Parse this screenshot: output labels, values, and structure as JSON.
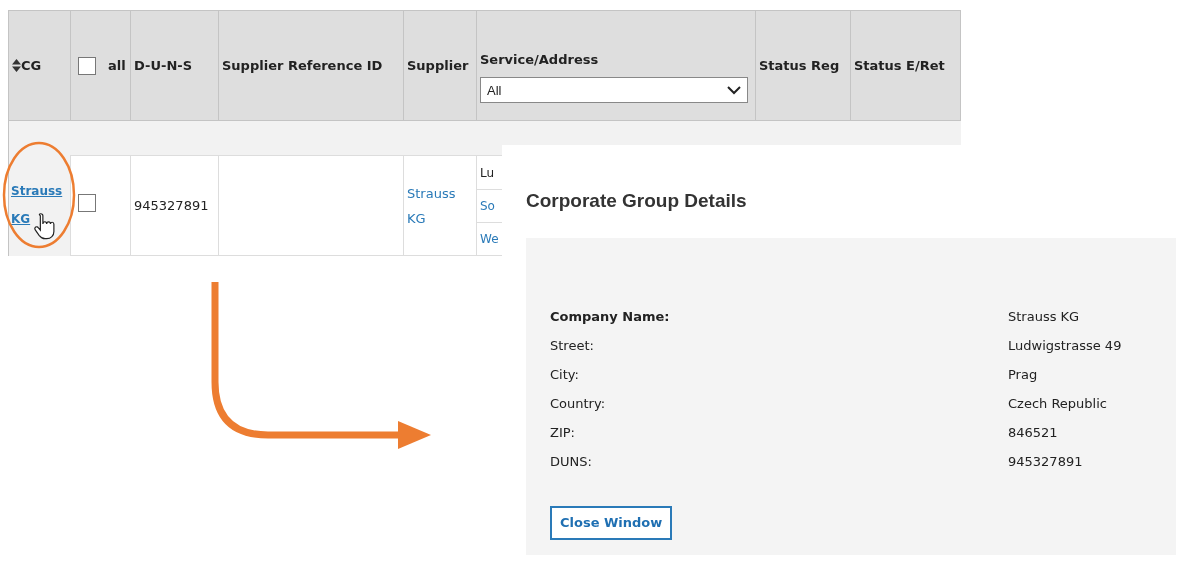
{
  "table": {
    "columns": [
      {
        "kind": "sortable",
        "label": "CG"
      },
      {
        "kind": "checkbox",
        "label": "all",
        "checked": false
      },
      {
        "kind": "plain",
        "label": "D-U-N-S"
      },
      {
        "kind": "plain",
        "label": "Supplier Reference ID"
      },
      {
        "kind": "plain",
        "label": "Supplier"
      },
      {
        "kind": "filter",
        "label": "Service/Address",
        "filter": "All"
      },
      {
        "kind": "plain",
        "label": "Status Reg"
      },
      {
        "kind": "plain",
        "label": "Status E/Ret"
      }
    ],
    "rows": [
      {
        "cg": "Strauss KG",
        "checked": false,
        "duns": "945327891",
        "supplier": "Strauss KG",
        "service_address": [
          {
            "kind": "text",
            "text": "Lu"
          },
          {
            "kind": "link",
            "text": "So"
          },
          {
            "kind": "link",
            "text": "We"
          }
        ]
      }
    ]
  },
  "dialog": {
    "title": "Corporate Group Details",
    "fields": [
      {
        "label": "Company Name:",
        "value": "Strauss KG",
        "bold": true
      },
      {
        "label": "Street:",
        "value": "Ludwigstrasse 49",
        "bold": false
      },
      {
        "label": "City:",
        "value": "Prag",
        "bold": false
      },
      {
        "label": "Country:",
        "value": "Czech Republic",
        "bold": false
      },
      {
        "label": "ZIP:",
        "value": "846521",
        "bold": false
      },
      {
        "label": "DUNS:",
        "value": "945327891",
        "bold": false
      }
    ],
    "button": "Close Window"
  }
}
